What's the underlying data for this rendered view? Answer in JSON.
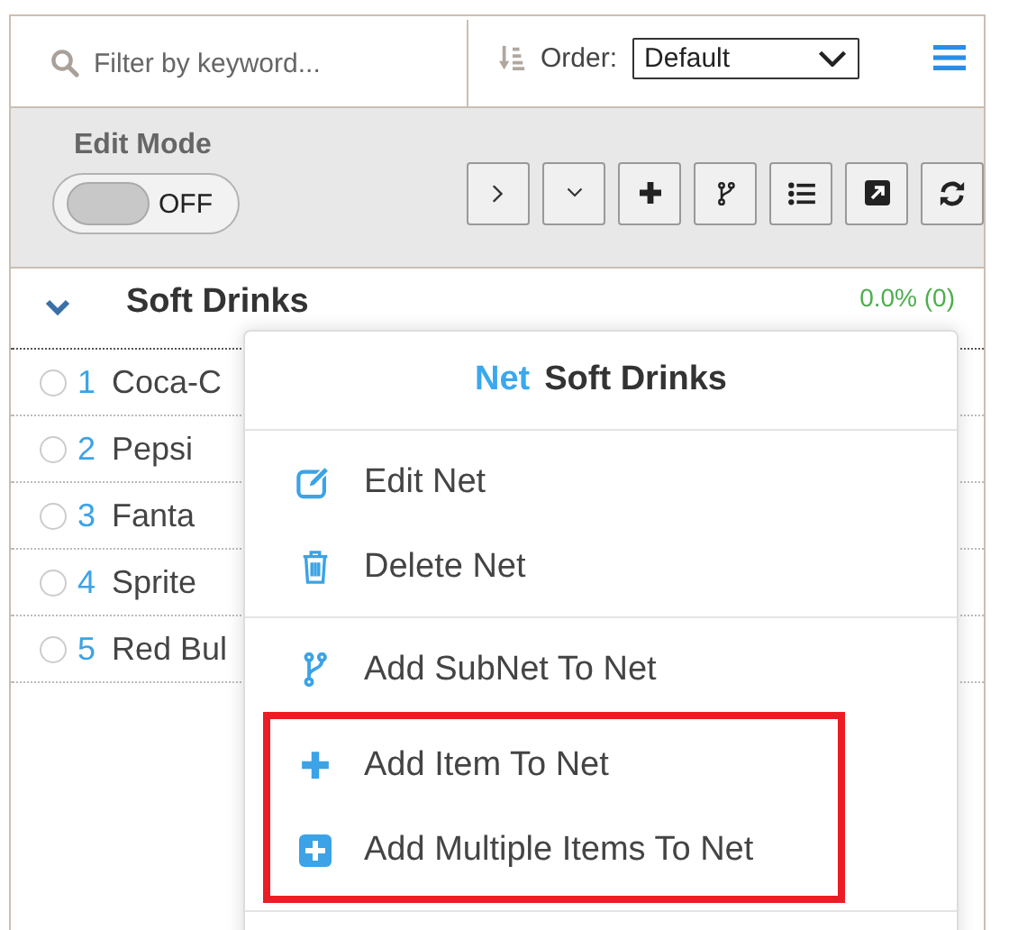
{
  "search": {
    "placeholder": "Filter by keyword..."
  },
  "order": {
    "label": "Order:",
    "value": "Default"
  },
  "edit_mode": {
    "label": "Edit Mode",
    "on": false,
    "state_text": "OFF"
  },
  "category": {
    "expanded": true,
    "name": "Soft Drinks",
    "stat": "0.0% (0)"
  },
  "items": [
    {
      "number": "1",
      "name": "Coca-C",
      "selected": false
    },
    {
      "number": "2",
      "name": "Pepsi",
      "selected": false
    },
    {
      "number": "3",
      "name": "Fanta",
      "selected": false
    },
    {
      "number": "4",
      "name": "Sprite",
      "selected": false
    },
    {
      "number": "5",
      "name": "Red Bul",
      "selected": false
    }
  ],
  "context_menu": {
    "title_prefix": "Net",
    "title": "Soft Drinks",
    "sections": [
      {
        "items": [
          {
            "kind": "edit",
            "label": "Edit Net",
            "highlighted": false
          },
          {
            "kind": "delete",
            "label": "Delete Net",
            "highlighted": false
          }
        ]
      },
      {
        "items": [
          {
            "kind": "add-subnet",
            "label": "Add SubNet To Net",
            "highlighted": false
          },
          {
            "kind": "add-item",
            "label": "Add Item To Net",
            "highlighted": true
          },
          {
            "kind": "add-multiple",
            "label": "Add Multiple Items To Net",
            "highlighted": true
          }
        ]
      }
    ]
  }
}
